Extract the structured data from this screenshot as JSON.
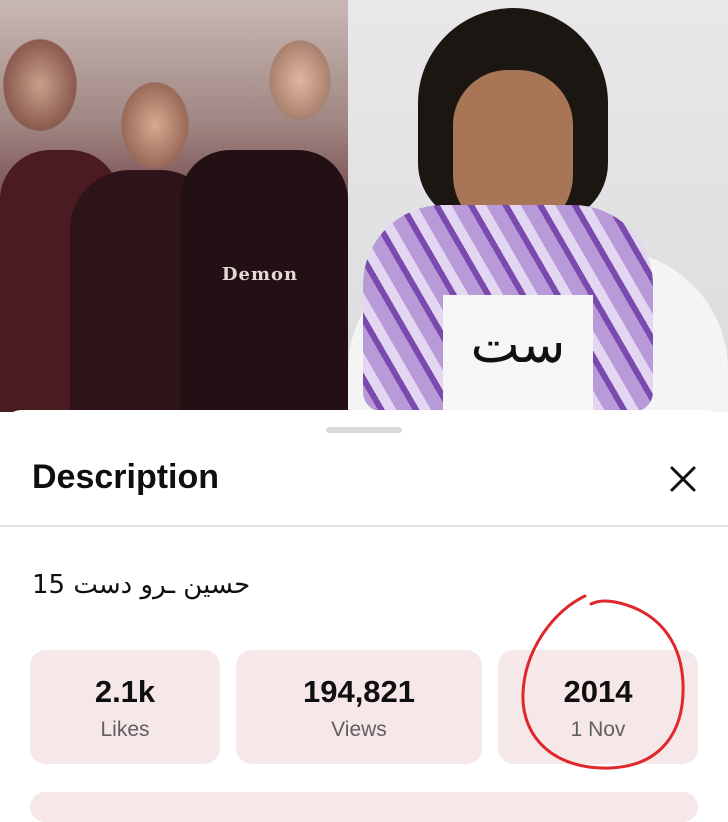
{
  "video": {
    "left_print_text": "Demon",
    "right_print_text": "ست"
  },
  "sheet": {
    "title": "Description",
    "close_icon": "close-icon",
    "video_title": "حسین ـرو دست 15"
  },
  "stats": [
    {
      "value": "2.1k",
      "label": "Likes"
    },
    {
      "value": "194,821",
      "label": "Views"
    },
    {
      "value": "2014",
      "label": "1 Nov"
    }
  ],
  "colors": {
    "card_bg": "#f6e7e8",
    "annotation": "#e0272b",
    "divider": "#e3e3e3"
  }
}
